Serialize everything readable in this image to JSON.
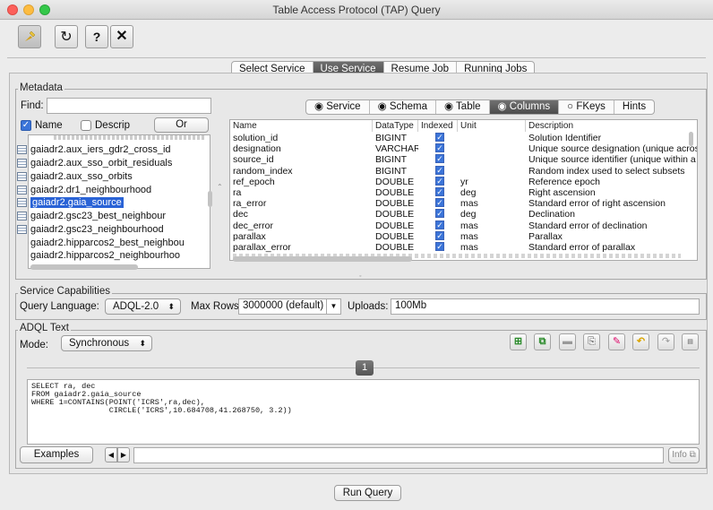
{
  "window": {
    "title": "Table Access Protocol (TAP) Query"
  },
  "toolbar": {
    "pin_icon": "pin-icon",
    "reload_icon": "reload-icon",
    "help_label": "?",
    "close_label": "✕"
  },
  "main_tabs": [
    "Select Service",
    "Use Service",
    "Resume Job",
    "Running Jobs"
  ],
  "metadata": {
    "group_label": "Metadata",
    "find_label": "Find:",
    "find_value": "",
    "name_label": "Name",
    "name_checked": true,
    "descrip_label": "Descrip",
    "descrip_checked": false,
    "or_label": "Or",
    "tree_items": [
      "gaiadr2.aux_iers_gdr2_cross_id",
      "gaiadr2.aux_sso_orbit_residuals",
      "gaiadr2.aux_sso_orbits",
      "gaiadr2.dr1_neighbourhood",
      "gaiadr2.gaia_source",
      "gaiadr2.gsc23_best_neighbour",
      "gaiadr2.gsc23_neighbourhood",
      "gaiadr2.hipparcos2_best_neighbou",
      "gaiadr2.hipparcos2_neighbourhoo"
    ],
    "selected_item": "gaiadr2.gaia_source",
    "sub_tabs": [
      "Service",
      "Schema",
      "Table",
      "Columns",
      "FKeys",
      "Hints"
    ],
    "columns_headers": [
      "Name",
      "DataType",
      "Indexed",
      "Unit",
      "Description"
    ],
    "columns_rows": [
      {
        "name": "solution_id",
        "type": "BIGINT",
        "indexed": true,
        "unit": "",
        "desc": "Solution Identifier"
      },
      {
        "name": "designation",
        "type": "VARCHAR",
        "indexed": true,
        "unit": "",
        "desc": "Unique source designation (unique across"
      },
      {
        "name": "source_id",
        "type": "BIGINT",
        "indexed": true,
        "unit": "",
        "desc": "Unique source identifier (unique within a"
      },
      {
        "name": "random_index",
        "type": "BIGINT",
        "indexed": true,
        "unit": "",
        "desc": "Random index used to select subsets"
      },
      {
        "name": "ref_epoch",
        "type": "DOUBLE",
        "indexed": true,
        "unit": "yr",
        "desc": "Reference epoch"
      },
      {
        "name": "ra",
        "type": "DOUBLE",
        "indexed": true,
        "unit": "deg",
        "desc": "Right ascension"
      },
      {
        "name": "ra_error",
        "type": "DOUBLE",
        "indexed": true,
        "unit": "mas",
        "desc": "Standard error of right ascension"
      },
      {
        "name": "dec",
        "type": "DOUBLE",
        "indexed": true,
        "unit": "deg",
        "desc": "Declination"
      },
      {
        "name": "dec_error",
        "type": "DOUBLE",
        "indexed": true,
        "unit": "mas",
        "desc": "Standard error of declination"
      },
      {
        "name": "parallax",
        "type": "DOUBLE",
        "indexed": true,
        "unit": "mas",
        "desc": "Parallax"
      },
      {
        "name": "parallax_error",
        "type": "DOUBLE",
        "indexed": true,
        "unit": "mas",
        "desc": "Standard error of parallax"
      }
    ]
  },
  "capabilities": {
    "group_label": "Service Capabilities",
    "query_language_label": "Query Language:",
    "query_language_value": "ADQL-2.0",
    "max_rows_label": "Max Rows:",
    "max_rows_value": "3000000 (default)",
    "uploads_label": "Uploads:",
    "uploads_value": "100Mb"
  },
  "adql": {
    "group_label": "ADQL Text",
    "mode_label": "Mode:",
    "mode_value": "Synchronous",
    "tab_number": "1",
    "query_text": "SELECT ra, dec\nFROM gaiadr2.gaia_source\nWHERE 1=CONTAINS(POINT('ICRS',ra,dec),\n                 CIRCLE('ICRS',10.684708,41.268750, 3.2))",
    "examples_label": "Examples",
    "info_label": "Info"
  },
  "run_query_label": "Run Query"
}
